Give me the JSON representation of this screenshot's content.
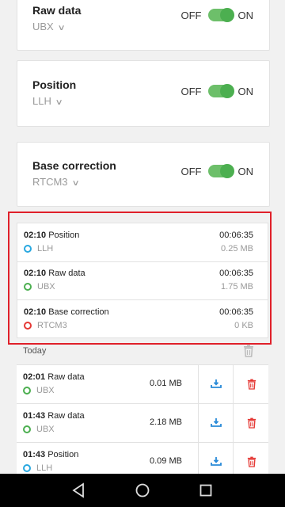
{
  "settings": [
    {
      "title": "Raw data",
      "format": "UBX",
      "off_label": "OFF",
      "on_label": "ON",
      "enabled": true
    },
    {
      "title": "Position",
      "format": "LLH",
      "off_label": "OFF",
      "on_label": "ON",
      "enabled": true
    },
    {
      "title": "Base correction",
      "format": "RTCM3",
      "off_label": "OFF",
      "on_label": "ON",
      "enabled": true
    }
  ],
  "active_logs": [
    {
      "time": "02:10",
      "name": "Position",
      "format": "LLH",
      "duration": "00:06:35",
      "size": "0.25 MB",
      "dot_color": "#29a8e0"
    },
    {
      "time": "02:10",
      "name": "Raw data",
      "format": "UBX",
      "duration": "00:06:35",
      "size": "1.75 MB",
      "dot_color": "#4caf50"
    },
    {
      "time": "02:10",
      "name": "Base correction",
      "format": "RTCM3",
      "duration": "00:06:35",
      "size": "0 KB",
      "dot_color": "#e53935"
    }
  ],
  "history": {
    "group_label": "Today",
    "items": [
      {
        "time": "02:01",
        "name": "Raw data",
        "format": "UBX",
        "size": "0.01 MB",
        "dot_color": "#4caf50"
      },
      {
        "time": "01:43",
        "name": "Raw data",
        "format": "UBX",
        "size": "2.18 MB",
        "dot_color": "#4caf50"
      },
      {
        "time": "01:43",
        "name": "Position",
        "format": "LLH",
        "size": "0.09 MB",
        "dot_color": "#29a8e0"
      }
    ]
  },
  "colors": {
    "toggle_on": "#4caf50",
    "highlight_border": "#e0202a",
    "delete_icon": "#e53935",
    "download_icon": "#2a8bd8"
  },
  "navbar": {
    "icons": [
      "back-icon",
      "home-icon",
      "recents-icon"
    ]
  }
}
